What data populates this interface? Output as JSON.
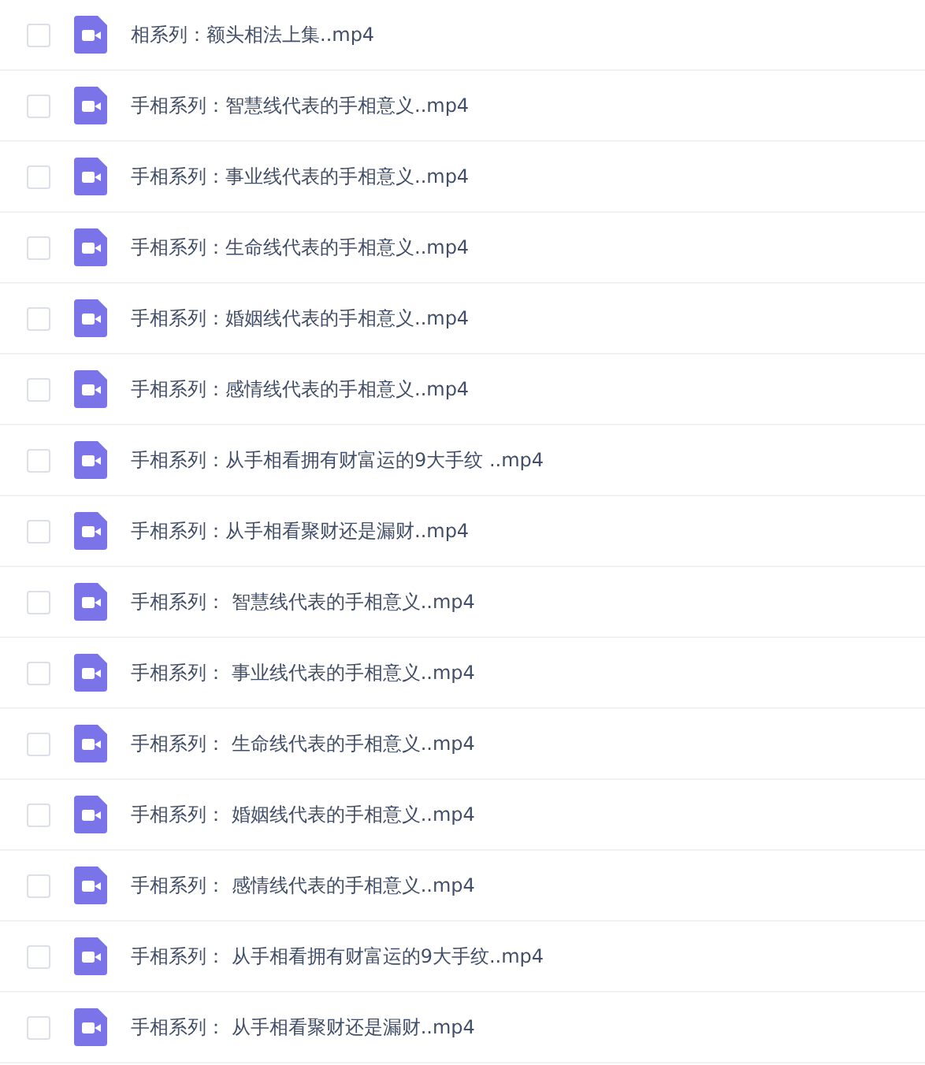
{
  "files": [
    {
      "name": "相系列：额头相法上集..mp4",
      "checked": false
    },
    {
      "name": "手相系列：智慧线代表的手相意义..mp4",
      "checked": false
    },
    {
      "name": "手相系列：事业线代表的手相意义..mp4",
      "checked": false
    },
    {
      "name": "手相系列：生命线代表的手相意义..mp4",
      "checked": false
    },
    {
      "name": "手相系列：婚姻线代表的手相意义..mp4",
      "checked": false
    },
    {
      "name": "手相系列：感情线代表的手相意义..mp4",
      "checked": false
    },
    {
      "name": "手相系列：从手相看拥有财富运的9大手纹 ..mp4",
      "checked": false
    },
    {
      "name": "手相系列：从手相看聚财还是漏财..mp4",
      "checked": false
    },
    {
      "name": "手相系列： 智慧线代表的手相意义..mp4",
      "checked": false
    },
    {
      "name": "手相系列： 事业线代表的手相意义..mp4",
      "checked": false
    },
    {
      "name": "手相系列： 生命线代表的手相意义..mp4",
      "checked": false
    },
    {
      "name": "手相系列： 婚姻线代表的手相意义..mp4",
      "checked": false
    },
    {
      "name": "手相系列： 感情线代表的手相意义..mp4",
      "checked": false
    },
    {
      "name": "手相系列： 从手相看拥有财富运的9大手纹..mp4",
      "checked": false
    },
    {
      "name": "手相系列： 从手相看聚财还是漏财..mp4",
      "checked": false
    }
  ]
}
